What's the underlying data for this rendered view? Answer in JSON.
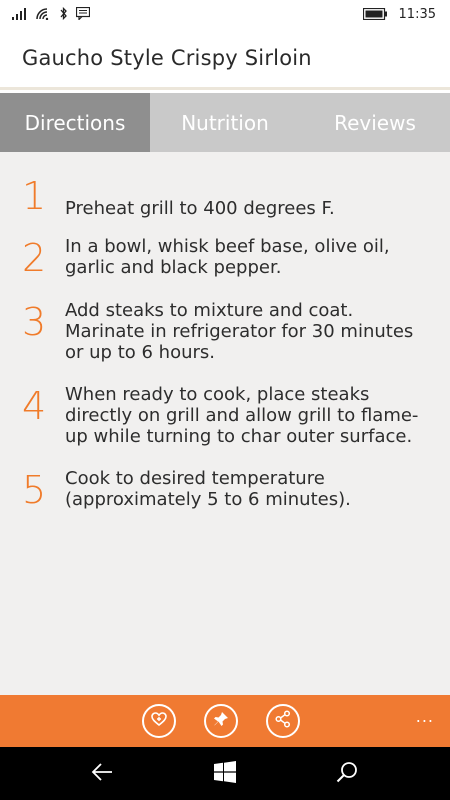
{
  "status_bar": {
    "time": "11:35",
    "icons": [
      "signal-icon",
      "wifi-icon",
      "bluetooth-icon",
      "notification-icon",
      "battery-icon"
    ]
  },
  "app": {
    "title": "Gaucho Style Crispy Sirloin"
  },
  "tabs": [
    {
      "label": "Directions",
      "active": true
    },
    {
      "label": "Nutrition",
      "active": false
    },
    {
      "label": "Reviews",
      "active": false
    }
  ],
  "directions": [
    {
      "number": "1",
      "text": "Preheat grill to 400 degrees F."
    },
    {
      "number": "2",
      "text": "In a bowl, whisk beef base, olive oil, garlic and black pepper."
    },
    {
      "number": "3",
      "text": "Add steaks to mixture and coat. Marinate in refrigerator for 30 minutes or up to 6 hours."
    },
    {
      "number": "4",
      "text": "When ready to cook, place steaks directly on grill and allow grill to flame-up while turning to char outer surface."
    },
    {
      "number": "5",
      "text": "Cook to desired temperature (approximately 5 to 6 minutes)."
    }
  ],
  "app_bar": {
    "buttons": [
      "favorite-icon",
      "pin-icon",
      "share-icon"
    ],
    "more": "..."
  },
  "nav_bar": {
    "buttons": [
      "back-icon",
      "windows-icon",
      "search-icon"
    ]
  },
  "colors": {
    "accent": "#f07a32",
    "step_number": "#f07b2a",
    "tab_bar": "#c9c9c9",
    "tab_active": "#8f8f8f",
    "content_bg": "#f1f0ef"
  }
}
